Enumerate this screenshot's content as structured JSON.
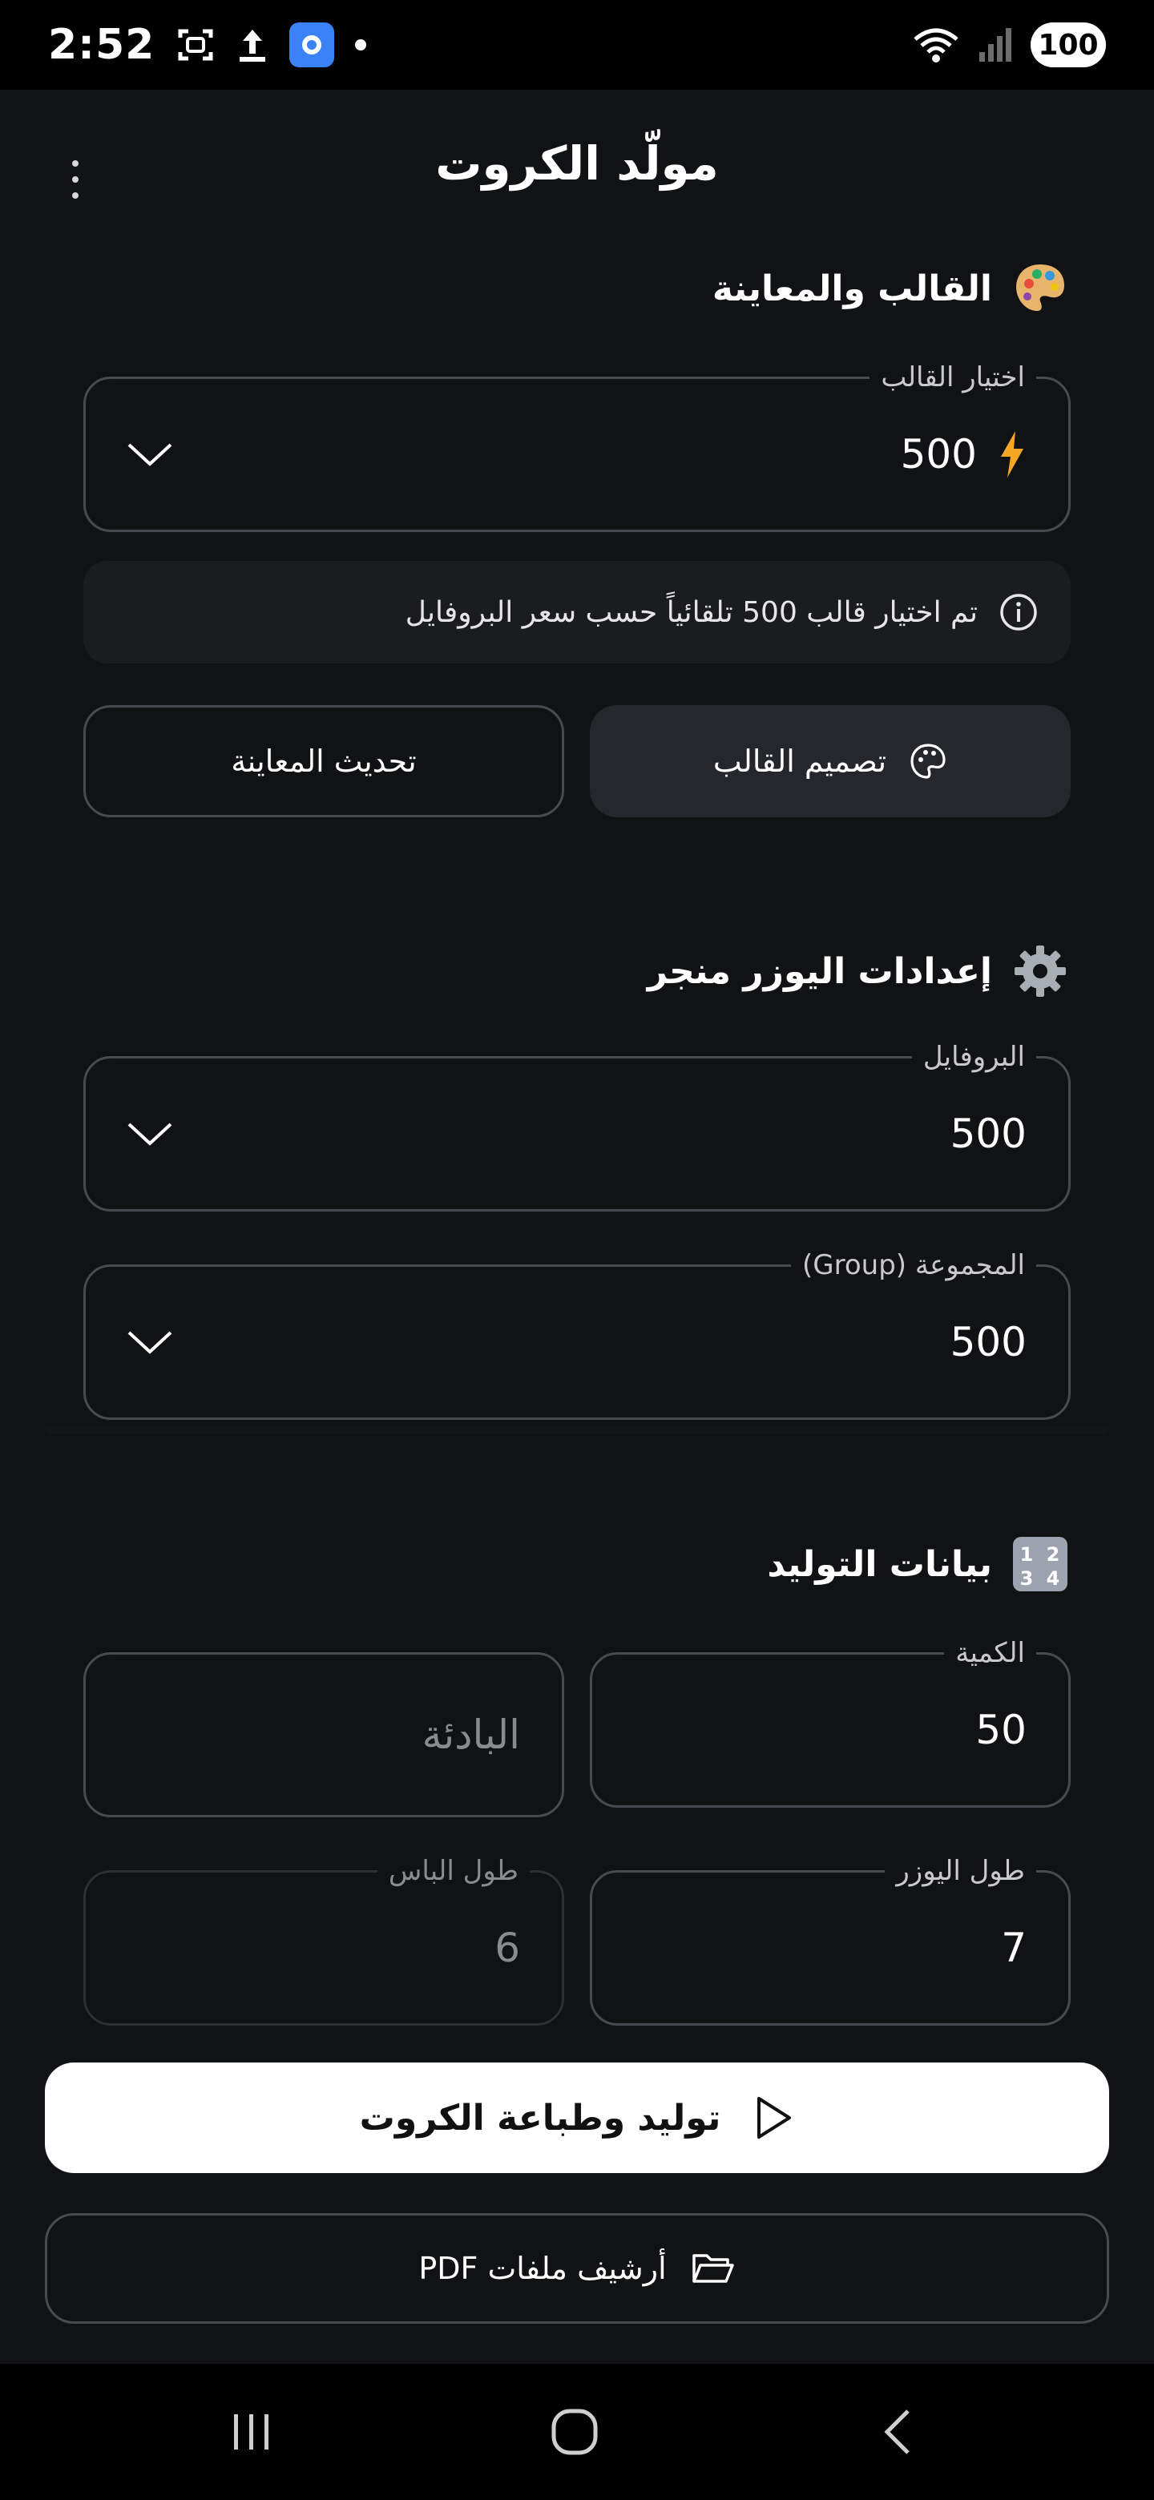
{
  "status_bar": {
    "time": "2:52",
    "battery": "100",
    "icons": [
      "screenshot-icon",
      "upload-icon",
      "app-icon",
      "notification-dot",
      "wifi-icon",
      "signal-icon"
    ]
  },
  "header": {
    "title": "مولّد الكروت",
    "menu_icon": "more-vertical-icon"
  },
  "template_section": {
    "title": "القالب والمعاينة",
    "emoji": "palette-icon",
    "template_select": {
      "label": "اختيار القالب",
      "value": "500",
      "value_icon": "lightning-icon"
    },
    "info_text": "تم اختيار قالب 500 تلقائياً حسب سعر البروفايل",
    "design_button": "تصميم القالب",
    "refresh_button": "تحديث المعاينة"
  },
  "usermanager_section": {
    "title": "إعدادات اليوزر منجر",
    "emoji": "gear-icon",
    "profile_select": {
      "label": "البروفايل",
      "value": "500"
    },
    "group_select": {
      "label": "المجموعة (Group)",
      "value": "500"
    }
  },
  "generation_section": {
    "title": "بيانات التوليد",
    "emoji": "numbers-icon",
    "quantity": {
      "label": "الكمية",
      "value": "50"
    },
    "prefix": {
      "placeholder": "البادئة"
    },
    "user_length": {
      "label": "طول اليوزر",
      "value": "7"
    },
    "pass_length": {
      "label": "طول الباس",
      "value": "6"
    }
  },
  "actions": {
    "generate_button": "توليد وطباعة الكروت",
    "archive_button": "أرشيف ملفات PDF"
  },
  "colors": {
    "background": "#111214",
    "field_border": "#4a4b50",
    "primary_button": "#ffffff",
    "accent_lightning": "#f5a623"
  }
}
